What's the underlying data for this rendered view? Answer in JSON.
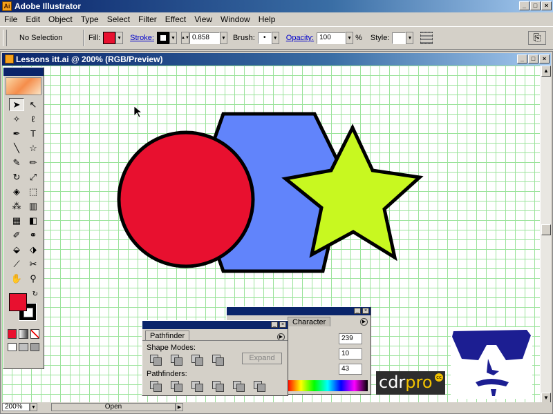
{
  "app": {
    "title": "Adobe Illustrator",
    "icon": "illustrator-app-icon"
  },
  "window_buttons": {
    "minimize": "_",
    "maximize": "□",
    "close": "×"
  },
  "menu": [
    "File",
    "Edit",
    "Object",
    "Type",
    "Select",
    "Filter",
    "Effect",
    "View",
    "Window",
    "Help"
  ],
  "control": {
    "selection": "No Selection",
    "fill_label": "Fill:",
    "fill_color": "#e8102f",
    "stroke_label": "Stroke:",
    "stroke_color": "#000000",
    "stroke_weight": "0.858",
    "brush_label": "Brush:",
    "brush_value": "•",
    "opacity_label": "Opacity:",
    "opacity_value": "100",
    "opacity_unit": "%",
    "style_label": "Style:"
  },
  "document": {
    "title": "Lessons itt.ai @ 200% (RGB/Preview)",
    "zoom": "200%",
    "status": "Open"
  },
  "shapes": {
    "circle_color": "#e8102f",
    "hexagon_color": "#6184fb",
    "star_color": "#c8f820",
    "outline_color": "#000000"
  },
  "pathfinder": {
    "tab": "Pathfinder",
    "shape_modes_label": "Shape Modes:",
    "expand_label": "Expand",
    "pathfinders_label": "Pathfinders:"
  },
  "character_panel": {
    "tab": "Character",
    "r": "239",
    "g": "10",
    "b": "43"
  },
  "watermark": {
    "brand": "cdr",
    "brand_accent": "pro",
    "badge": "cc"
  },
  "colors": {
    "accent": "#0a246a",
    "grid": "#9ae39a"
  }
}
